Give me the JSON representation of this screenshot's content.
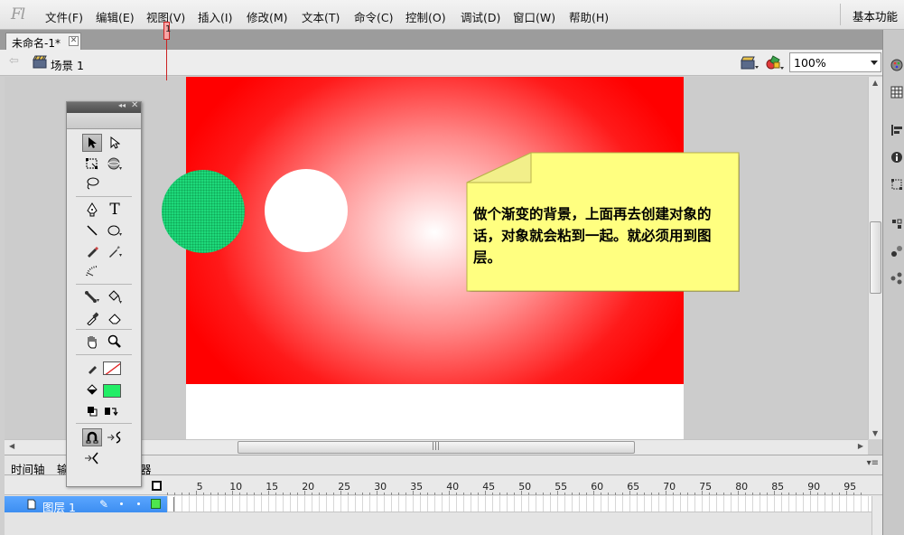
{
  "app": {
    "logo": "Fl"
  },
  "menubar": {
    "items": [
      "文件(F)",
      "编辑(E)",
      "视图(V)",
      "插入(I)",
      "修改(M)",
      "文本(T)",
      "命令(C)",
      "控制(O)",
      "调试(D)",
      "窗口(W)",
      "帮助(H)"
    ],
    "workspace_label": "基本功能"
  },
  "document": {
    "tab_title": "未命名-1*",
    "close_glyph": "✕"
  },
  "editbar": {
    "back_glyph": "⇦",
    "scene_label": "场景 1",
    "zoom_value": "100%"
  },
  "stage": {
    "note_text": "做个渐变的背景，上面再去创建对象的话，对象就会粘到一起。就必须用到图层。",
    "gradient_colors": {
      "center": "#ffffff",
      "edge": "#ff0000"
    },
    "green_circle_color": "#1ed97a",
    "white_circle_color": "#ffffff",
    "note_color": "#ffff80"
  },
  "tools": {
    "collapse_glyph": "◂◂",
    "close_glyph": "✕",
    "items": [
      "selection-tool",
      "subselection-tool",
      "free-transform-tool",
      "3d-rotation-tool",
      "lasso-tool",
      "pen-tool",
      "text-tool",
      "line-tool",
      "oval-tool",
      "pencil-tool",
      "brush-tool",
      "deco-tool",
      "bone-tool",
      "paint-bucket-tool",
      "eyedropper-tool",
      "eraser-tool",
      "hand-tool",
      "zoom-tool",
      "stroke-color",
      "fill-color",
      "black-white",
      "swap-colors",
      "snap-to-objects",
      "smooth",
      "straighten"
    ],
    "text_tool_glyph": "T",
    "stroke_color": "none",
    "fill_color": "#22ee66"
  },
  "timeline": {
    "tabs": [
      "时间轴",
      "输",
      "器"
    ],
    "menu_glyph": "▾≡",
    "frame_numbers": [
      "5",
      "10",
      "15",
      "20",
      "25",
      "30",
      "35",
      "40",
      "45",
      "50",
      "55",
      "60",
      "65",
      "70",
      "75",
      "80",
      "85",
      "90",
      "95"
    ],
    "current_frame": "1",
    "layer": {
      "name": "图层 1",
      "pencil_glyph": "✎",
      "color": "#4ee64e"
    }
  },
  "scrollbars": {
    "grip": "|||",
    "up": "▲",
    "down": "▼",
    "left": "◀",
    "right": "▶"
  }
}
